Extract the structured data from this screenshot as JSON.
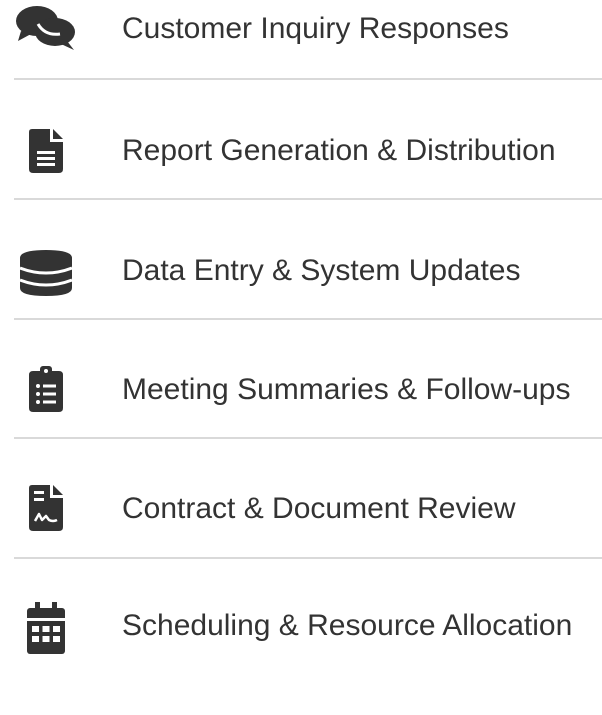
{
  "items": [
    {
      "label": "Customer Inquiry Responses",
      "icon": "comments-icon"
    },
    {
      "label": "Report Generation & Distribution",
      "icon": "file-lines-icon"
    },
    {
      "label": "Data Entry & System Updates",
      "icon": "database-icon"
    },
    {
      "label": "Meeting Summaries & Follow-ups",
      "icon": "clipboard-list-icon"
    },
    {
      "label": "Contract & Document Review",
      "icon": "file-contract-icon"
    },
    {
      "label": "Scheduling & Resource Allocation",
      "icon": "calendar-days-icon"
    }
  ],
  "colors": {
    "icon": "#333333",
    "text": "#333333",
    "divider": "#d9d9d9",
    "background": "#ffffff"
  }
}
